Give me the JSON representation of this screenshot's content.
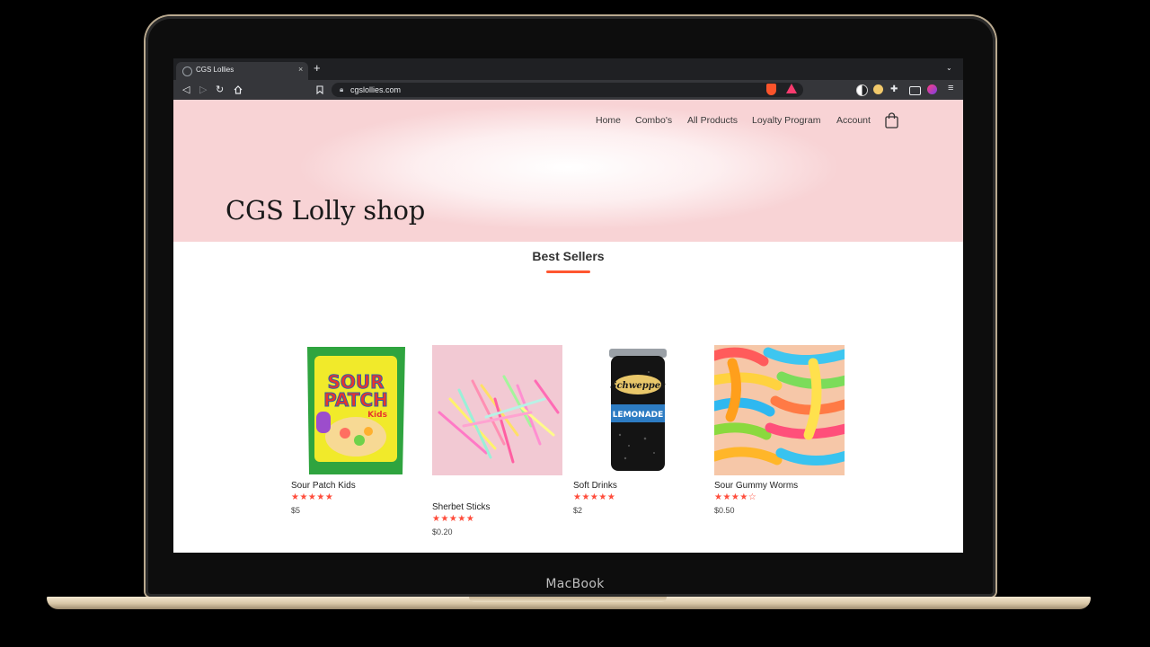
{
  "device": {
    "label": "MacBook"
  },
  "browser": {
    "tab_title": "CGS Lollies",
    "tab_close": "×",
    "new_tab": "+",
    "tab_menu": "⌄",
    "url": "cgslollies.com",
    "menu": "≡"
  },
  "site": {
    "nav": [
      "Home",
      "Combo's",
      "All Products",
      "Loyalty Program",
      "Account"
    ],
    "hero_title": "CGS Lolly shop",
    "section_title": "Best Sellers",
    "products": [
      {
        "name": "Sour Patch Kids",
        "rating": 5,
        "stars": "★★★★★",
        "price": "$5"
      },
      {
        "name": "Sherbet Sticks",
        "rating": 5,
        "stars": "★★★★★",
        "price": "$0.20"
      },
      {
        "name": "Soft Drinks",
        "rating": 5,
        "stars": "★★★★★",
        "price": "$2"
      },
      {
        "name": "Sour Gummy Worms",
        "rating": 4,
        "stars": "★★★★☆",
        "price": "$0.50"
      }
    ],
    "product_image_text": {
      "sour_patch": [
        "SOUR",
        "PATCH",
        "Kids"
      ],
      "drink": [
        "Schweppes",
        "LEMONADE"
      ]
    }
  },
  "colors": {
    "accent": "#ff5630",
    "star": "#ff4c3b",
    "hero_pink": "#f8d3d5"
  }
}
